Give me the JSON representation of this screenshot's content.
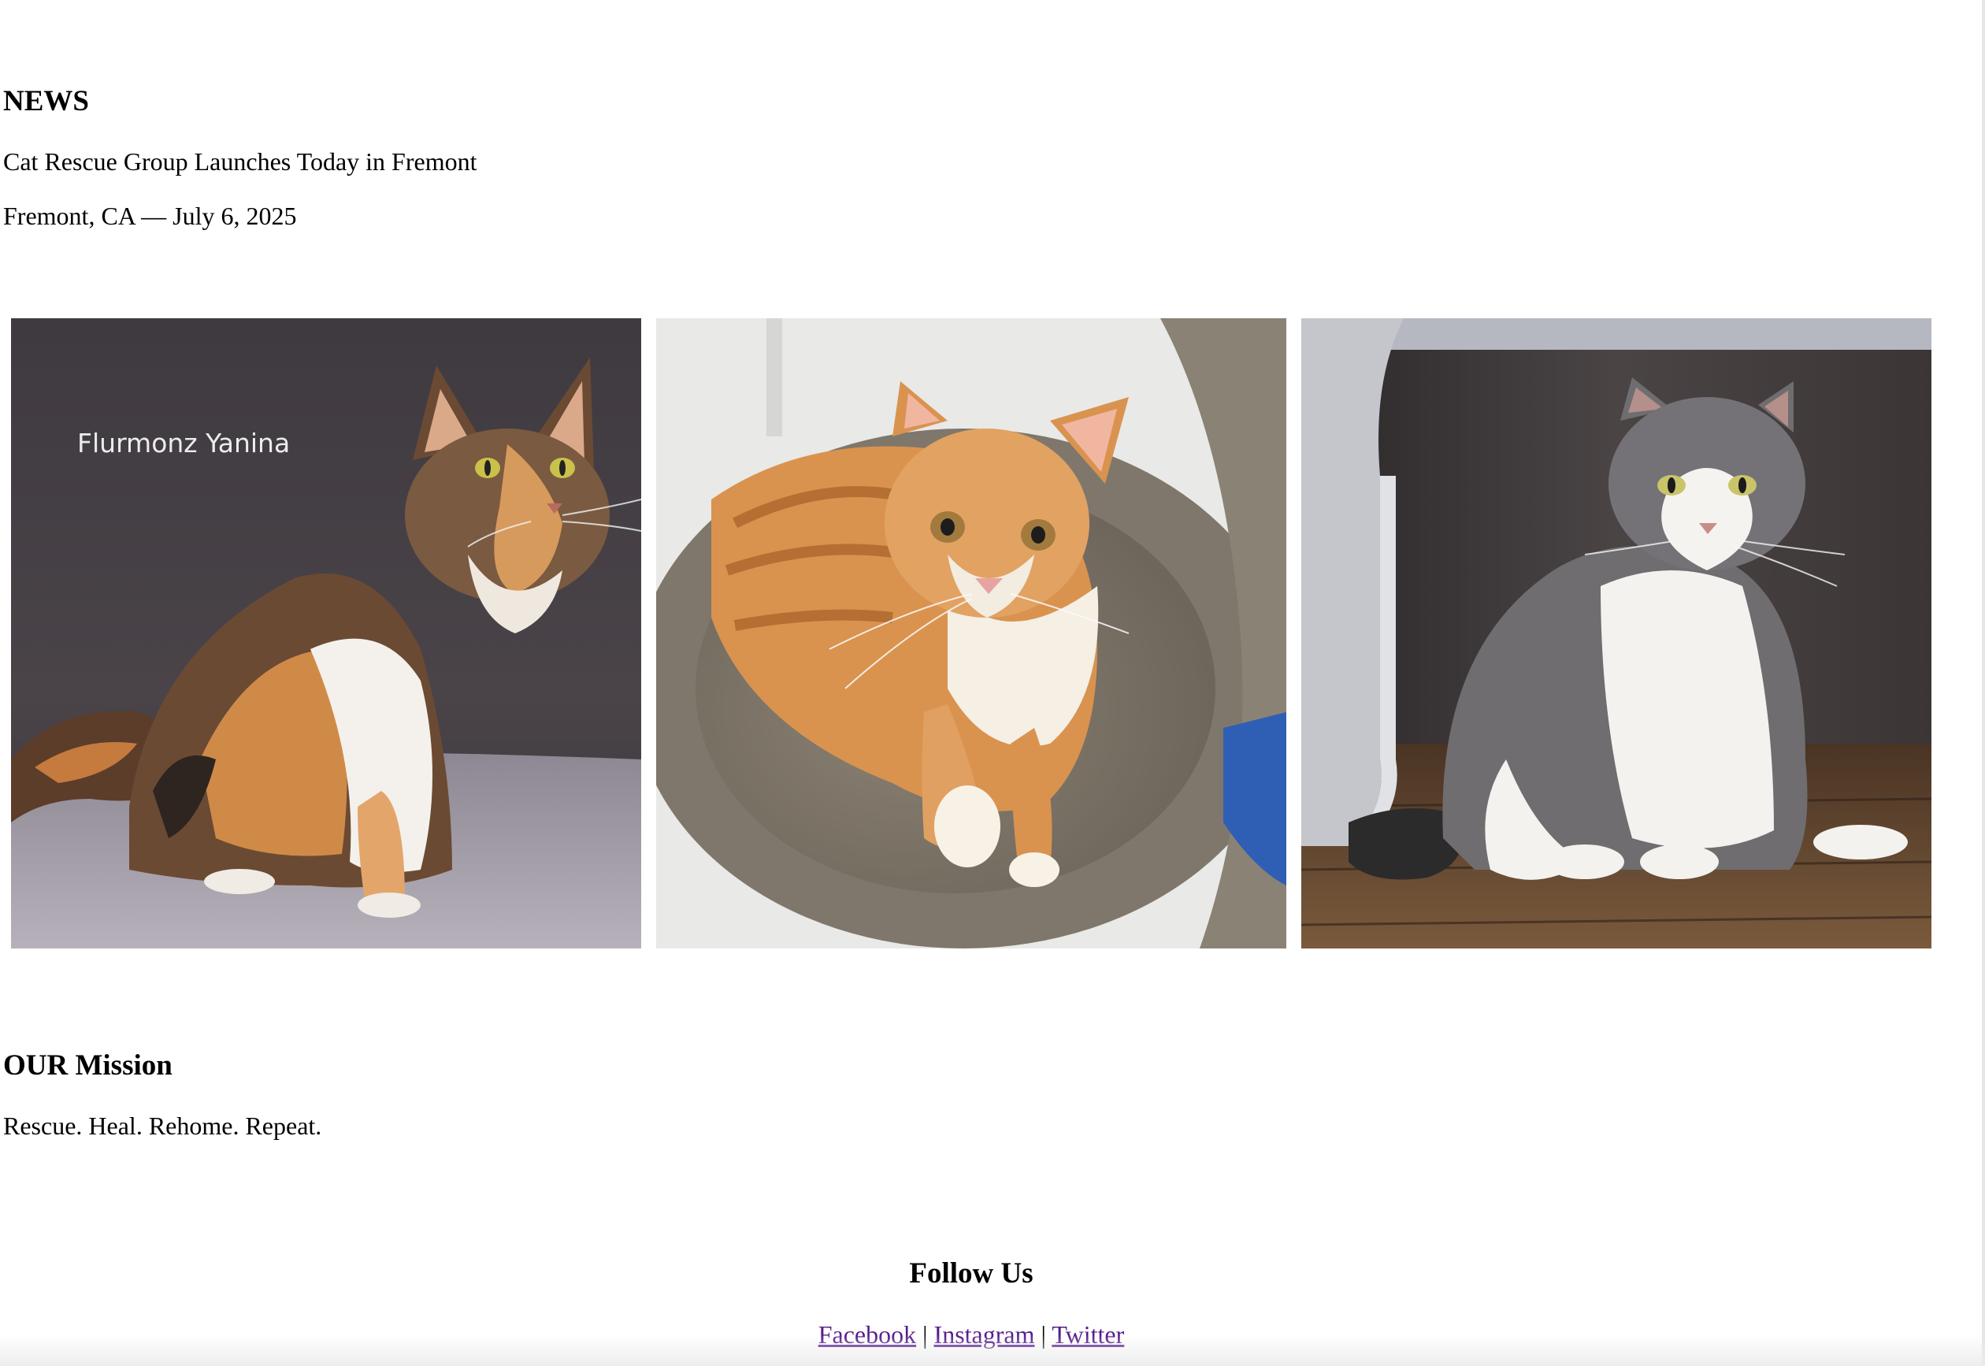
{
  "news": {
    "heading": "NEWS",
    "headline": "Cat Rescue Group Launches Today in Fremont",
    "dateline": "Fremont, CA — July 6, 2025"
  },
  "gallery": {
    "photo1_caption": "Flurmonz Yanina"
  },
  "mission": {
    "heading": "OUR Mission",
    "text": "Rescue. Heal. Rehome. Repeat."
  },
  "footer": {
    "heading": "Follow Us",
    "links": [
      "Facebook",
      "Instagram",
      "Twitter"
    ],
    "separator": "|"
  },
  "colors": {
    "visited_link": "#551a8b",
    "text": "#000000",
    "background": "#ffffff"
  }
}
